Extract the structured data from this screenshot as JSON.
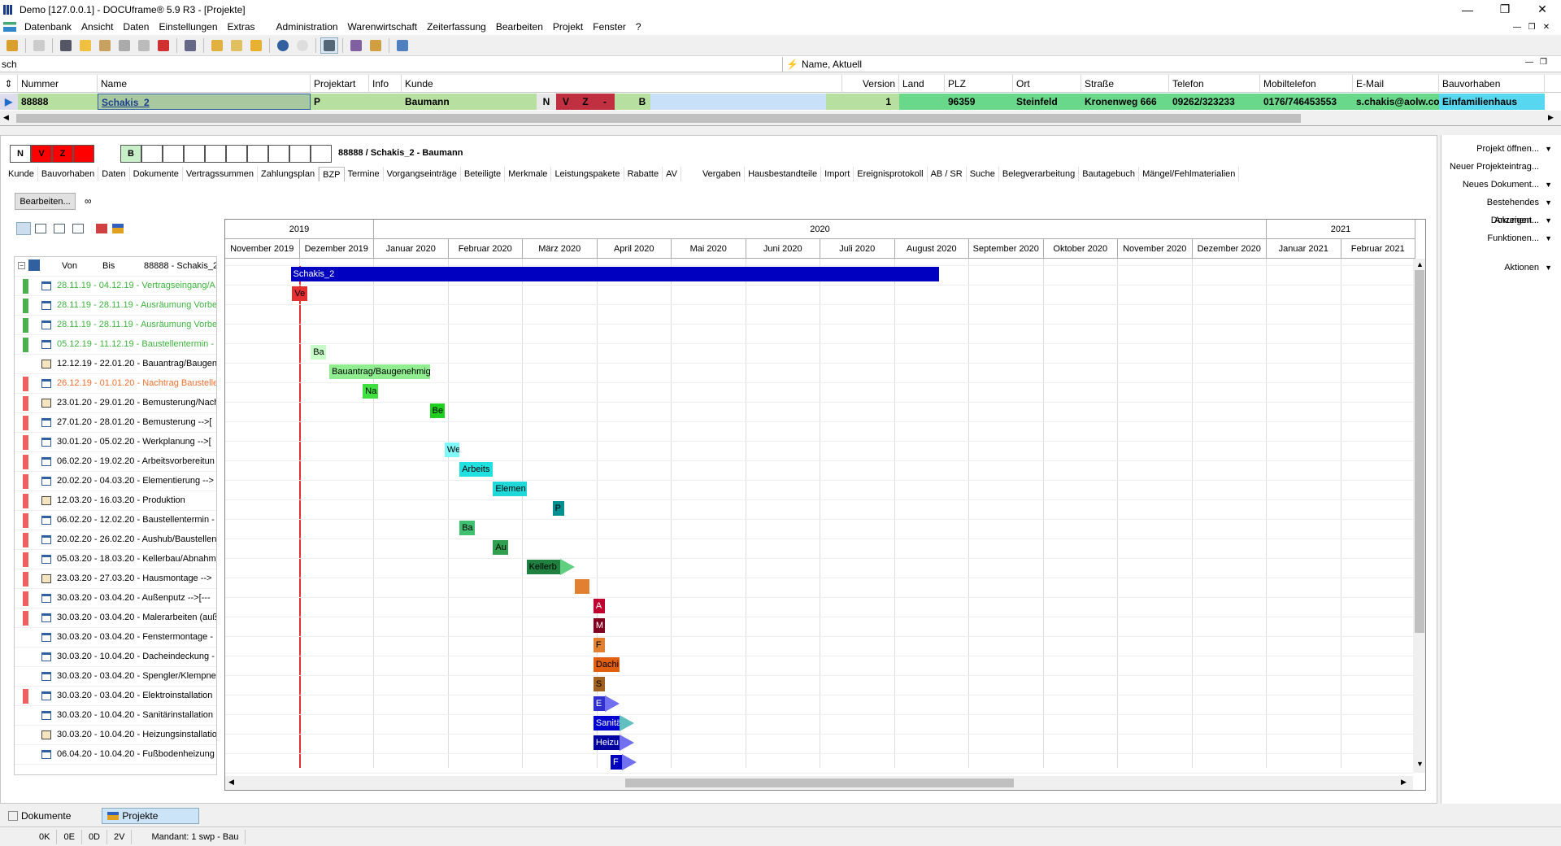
{
  "window": {
    "title": "Demo [127.0.0.1] - DOCUframe® 5.9 R3 - [Projekte]"
  },
  "menu": [
    "Datenbank",
    "Ansicht",
    "Daten",
    "Einstellungen",
    "Extras",
    "Administration",
    "Warenwirtschaft",
    "Zeiterfassung",
    "Bearbeiten",
    "Projekt",
    "Fenster",
    "?"
  ],
  "search": {
    "value": "sch",
    "sort_field": "Name, Aktuell"
  },
  "grid": {
    "columns": [
      "Nummer",
      "Name",
      "Projektart",
      "Info",
      "Kunde",
      "Version",
      "Land",
      "PLZ",
      "Ort",
      "Straße",
      "Telefon",
      "Mobiltelefon",
      "E-Mail",
      "Bauvorhaben"
    ],
    "row": {
      "nummer": "88888",
      "name": "Schakis_2",
      "projektart": "P",
      "kunde": "Baumann",
      "flag_n": "N",
      "flag_v": "V",
      "flag_z": "Z",
      "flag_dash": "-",
      "flag_b": "B",
      "version": "1",
      "land": "",
      "plz": "96359",
      "ort": "Steinfeld",
      "strasse": "Kronenweg 666",
      "telefon": "09262/323233",
      "mobil": "0176/746453553",
      "email": "s.chakis@aolw.cor",
      "bauvorhaben": "Einfamilienhaus"
    }
  },
  "detail": {
    "flags": [
      "N",
      "V",
      "Z",
      "",
      "B"
    ],
    "title": "88888 / Schakis_2 - Baumann",
    "tabs": [
      "Kunde",
      "Bauvorhaben",
      "Daten",
      "Dokumente",
      "Vertragssummen",
      "Zahlungsplan",
      "BZP",
      "Termine",
      "Vorgangseinträge",
      "Beteiligte",
      "Merkmale",
      "Leistungspakete",
      "Rabatte",
      "AV",
      "Vergaben",
      "Hausbestandteile",
      "Import",
      "Ereignisprotokoll",
      "AB / SR",
      "Suche",
      "Belegverarbeitung",
      "Bautagebuch",
      "Mängel/Fehlmaterialien"
    ],
    "active_tab": "BZP",
    "edit_button": "Bearbeiten..."
  },
  "list": {
    "header": {
      "von": "Von",
      "bis": "Bis",
      "title": "88888 - Schakis_2"
    },
    "rows": [
      {
        "text": "28.11.19 - 04.12.19 - Vertragseingang/A",
        "bar": "#4caf50",
        "color": "#3cb43c",
        "icon": "cal"
      },
      {
        "text": "28.11.19 - 28.11.19 - Ausräumung Vorbe",
        "bar": "#4caf50",
        "color": "#3cb43c",
        "icon": "cal"
      },
      {
        "text": "28.11.19 - 28.11.19 - Ausräumung Vorbe",
        "bar": "#4caf50",
        "color": "#3cb43c",
        "icon": "cal"
      },
      {
        "text": "05.12.19 - 11.12.19 - Baustellentermin - I",
        "bar": "#4caf50",
        "color": "#3cb43c",
        "icon": "cal"
      },
      {
        "text": "12.12.19 - 22.01.20 - Bauantrag/Baugen",
        "bar": "",
        "color": "#000",
        "icon": "clip"
      },
      {
        "text": "26.12.19 - 01.01.20 - Nachtrag Baustelle",
        "bar": "#f06060",
        "color": "#f07030",
        "icon": "cal"
      },
      {
        "text": "23.01.20 - 29.01.20 - Bemusterung/Nach",
        "bar": "#f06060",
        "color": "#000",
        "icon": "clip"
      },
      {
        "text": "27.01.20 - 28.01.20 - Bemusterung  -->[",
        "bar": "#f06060",
        "color": "#000",
        "icon": "cal"
      },
      {
        "text": "30.01.20 - 05.02.20 - Werkplanung  -->[",
        "bar": "#f06060",
        "color": "#000",
        "icon": "cal"
      },
      {
        "text": "06.02.20 - 19.02.20 - Arbeitsvorbereitun",
        "bar": "#f06060",
        "color": "#000",
        "icon": "cal"
      },
      {
        "text": "20.02.20 - 04.03.20 - Elementierung  -->",
        "bar": "#f06060",
        "color": "#000",
        "icon": "cal"
      },
      {
        "text": "12.03.20 - 16.03.20 - Produktion",
        "bar": "#f06060",
        "color": "#000",
        "icon": "clip"
      },
      {
        "text": "06.02.20 - 12.02.20 - Baustellentermin -",
        "bar": "#f06060",
        "color": "#000",
        "icon": "cal"
      },
      {
        "text": "20.02.20 - 26.02.20 - Aushub/Baustellen",
        "bar": "#f06060",
        "color": "#000",
        "icon": "cal"
      },
      {
        "text": "05.03.20 - 18.03.20 - Kellerbau/Abnahm",
        "bar": "#f06060",
        "color": "#000",
        "icon": "cal"
      },
      {
        "text": "23.03.20 - 27.03.20 - Hausmontage  -->",
        "bar": "#f06060",
        "color": "#000",
        "icon": "clip"
      },
      {
        "text": "30.03.20 - 03.04.20 - Außenputz  -->[---",
        "bar": "#f06060",
        "color": "#000",
        "icon": "cal"
      },
      {
        "text": "30.03.20 - 03.04.20 - Malerarbeiten (auß",
        "bar": "#f06060",
        "color": "#000",
        "icon": "cal"
      },
      {
        "text": "30.03.20 - 03.04.20 - Fenstermontage  -",
        "bar": "",
        "color": "#000",
        "icon": "cal"
      },
      {
        "text": "30.03.20 - 10.04.20 - Dacheindeckung  -",
        "bar": "",
        "color": "#000",
        "icon": "cal"
      },
      {
        "text": "30.03.20 - 03.04.20 - Spengler/Klempner",
        "bar": "",
        "color": "#000",
        "icon": "cal"
      },
      {
        "text": "30.03.20 - 03.04.20 - Elektroinstallation",
        "bar": "#f06060",
        "color": "#000",
        "icon": "cal"
      },
      {
        "text": "30.03.20 - 10.04.20 - Sanitärinstallation",
        "bar": "",
        "color": "#000",
        "icon": "cal"
      },
      {
        "text": "30.03.20 - 10.04.20 - Heizungsinstallatio",
        "bar": "",
        "color": "#000",
        "icon": "clip"
      },
      {
        "text": "06.04.20 - 10.04.20 - Fußbodenheizung",
        "bar": "",
        "color": "#000",
        "icon": "cal"
      }
    ]
  },
  "gantt": {
    "years": [
      {
        "label": "2019",
        "span": 2
      },
      {
        "label": "2020",
        "span": 12
      },
      {
        "label": "2021",
        "span": 2
      }
    ],
    "months": [
      "November 2019",
      "Dezember 2019",
      "Januar 2020",
      "Februar 2020",
      "März 2020",
      "April 2020",
      "Mai 2020",
      "Juni 2020",
      "Juli 2020",
      "August 2020",
      "September 2020",
      "Oktober 2020",
      "November 2020",
      "Dezember 2020",
      "Januar 2021",
      "Februar 2021"
    ],
    "bars": [
      {
        "label": "Schakis_2",
        "row": 0,
        "start": 0.88,
        "end": 9.6,
        "color": "#0000c0",
        "text": "#fff"
      },
      {
        "label": "Ve",
        "row": 1,
        "start": 0.9,
        "end": 1.1,
        "color": "#e53030",
        "text": "#000"
      },
      {
        "label": "Ba",
        "row": 4,
        "start": 1.15,
        "end": 1.35,
        "color": "#c8ffc8",
        "text": "#000"
      },
      {
        "label": "Bauantrag/Baugenehmig",
        "row": 5,
        "start": 1.4,
        "end": 2.75,
        "color": "#90ee90",
        "text": "#000"
      },
      {
        "label": "Na",
        "row": 6,
        "start": 1.85,
        "end": 2.05,
        "color": "#40e040",
        "text": "#000"
      },
      {
        "label": "Be",
        "row": 7,
        "start": 2.75,
        "end": 2.95,
        "color": "#20d020",
        "text": "#000"
      },
      {
        "label": "We",
        "row": 9,
        "start": 2.95,
        "end": 3.15,
        "color": "#80f8f8",
        "text": "#000"
      },
      {
        "label": "Arbeits",
        "row": 10,
        "start": 3.15,
        "end": 3.6,
        "color": "#20e0e0",
        "text": "#000"
      },
      {
        "label": "Elemen",
        "row": 11,
        "start": 3.6,
        "end": 4.05,
        "color": "#20d8d8",
        "text": "#000"
      },
      {
        "label": "P",
        "row": 12,
        "start": 4.4,
        "end": 4.55,
        "color": "#009090",
        "text": "#000"
      },
      {
        "label": "Ba",
        "row": 13,
        "start": 3.15,
        "end": 3.35,
        "color": "#40c070",
        "text": "#000"
      },
      {
        "label": "Au",
        "row": 14,
        "start": 3.6,
        "end": 3.8,
        "color": "#30a050",
        "text": "#000"
      },
      {
        "label": "Kellerb",
        "row": 15,
        "start": 4.05,
        "end": 4.5,
        "color": "#208040",
        "text": "#000"
      },
      {
        "label": "",
        "row": 16,
        "start": 4.7,
        "end": 4.9,
        "color": "#e08030",
        "text": "#000"
      },
      {
        "label": "A",
        "row": 17,
        "start": 4.95,
        "end": 5.08,
        "color": "#c00030",
        "text": "#fff"
      },
      {
        "label": "M",
        "row": 18,
        "start": 4.95,
        "end": 5.08,
        "color": "#800020",
        "text": "#fff"
      },
      {
        "label": "F",
        "row": 19,
        "start": 4.95,
        "end": 5.08,
        "color": "#e08030",
        "text": "#000"
      },
      {
        "label": "Dachi",
        "row": 20,
        "start": 4.95,
        "end": 5.3,
        "color": "#e06010",
        "text": "#000"
      },
      {
        "label": "S",
        "row": 21,
        "start": 4.95,
        "end": 5.08,
        "color": "#a06020",
        "text": "#000"
      },
      {
        "label": "E",
        "row": 22,
        "start": 4.95,
        "end": 5.08,
        "color": "#3030d0",
        "text": "#fff"
      },
      {
        "label": "Sanitä",
        "row": 23,
        "start": 4.95,
        "end": 5.3,
        "color": "#0000d0",
        "text": "#fff"
      },
      {
        "label": "Heizu",
        "row": 24,
        "start": 4.95,
        "end": 5.3,
        "color": "#0000a0",
        "text": "#fff"
      },
      {
        "label": "F",
        "row": 25,
        "start": 5.18,
        "end": 5.31,
        "color": "#0000c0",
        "text": "#fff"
      }
    ]
  },
  "right_panel": [
    {
      "label": "Projekt öffnen...",
      "arrow": true
    },
    {
      "label": "Neuer Projekteintrag...",
      "arrow": false
    },
    {
      "label": "Neues Dokument...",
      "arrow": true
    },
    {
      "label": "Bestehendes Dokument...",
      "arrow": true
    },
    {
      "label": "Anzeigen...",
      "arrow": true
    },
    {
      "label": "Funktionen...",
      "arrow": true
    },
    {
      "label": "Aktionen",
      "arrow": true
    }
  ],
  "bottom_tabs": [
    "Dokumente",
    "Projekte"
  ],
  "status": [
    "0K",
    "0E",
    "0D",
    "2V",
    "Mandant: 1 swp - Bau"
  ]
}
